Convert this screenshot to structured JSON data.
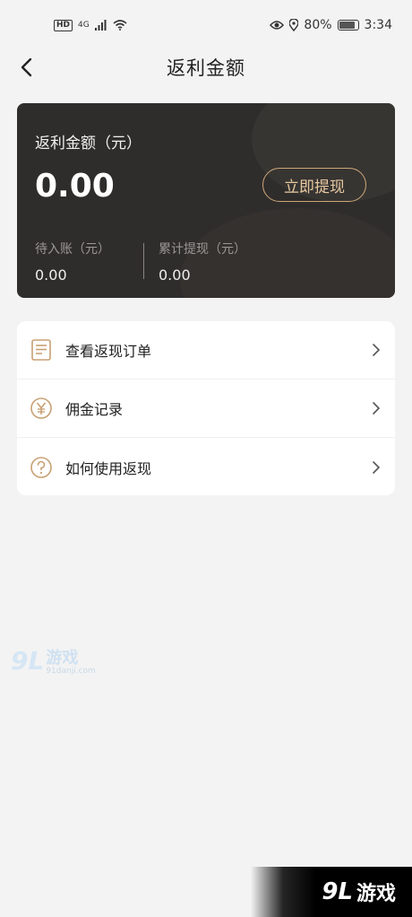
{
  "status_bar": {
    "hd": "HD",
    "network": "4G",
    "battery_percent": "80%",
    "time": "3:34",
    "icons": [
      "signal-icon",
      "wifi-icon",
      "eye-icon",
      "location-icon",
      "battery-icon"
    ]
  },
  "header": {
    "title": "返利金额",
    "back_icon": "chevron-left-icon"
  },
  "balance_card": {
    "label": "返利金额（元）",
    "amount": "0.00",
    "withdraw_label": "立即提现",
    "pending": {
      "label": "待入账（元）",
      "value": "0.00"
    },
    "total_withdrawn": {
      "label": "累计提现（元）",
      "value": "0.00"
    }
  },
  "menu": {
    "items": [
      {
        "label": "查看返现订单",
        "icon": "document-icon"
      },
      {
        "label": "佣金记录",
        "icon": "yen-coin-icon"
      },
      {
        "label": "如何使用返现",
        "icon": "question-icon"
      }
    ]
  },
  "watermark": {
    "logo": "9L",
    "name": "游戏",
    "url": "91danji.com"
  },
  "colors": {
    "card_bg": "#2f2d2b",
    "accent_gold": "#cfa67a",
    "page_bg": "#f3f3f3"
  }
}
